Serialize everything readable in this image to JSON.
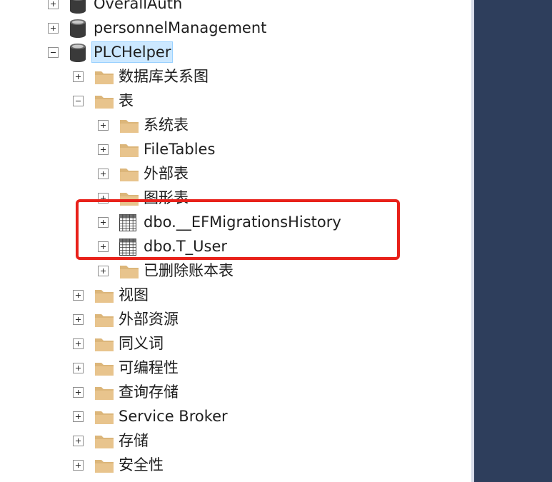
{
  "tree": {
    "nodes": [
      {
        "label": "OverallAuth",
        "type": "database",
        "level": 0,
        "expanded": false
      },
      {
        "label": "personnelManagement",
        "type": "database",
        "level": 0,
        "expanded": false
      },
      {
        "label": "PLCHelper",
        "type": "database",
        "level": 0,
        "expanded": true,
        "selected": true
      },
      {
        "label": "数据库关系图",
        "type": "folder",
        "level": 1,
        "expanded": false
      },
      {
        "label": "表",
        "type": "folder",
        "level": 1,
        "expanded": true
      },
      {
        "label": "系统表",
        "type": "folder",
        "level": 2,
        "expanded": false
      },
      {
        "label": "FileTables",
        "type": "folder",
        "level": 2,
        "expanded": false
      },
      {
        "label": "外部表",
        "type": "folder",
        "level": 2,
        "expanded": false
      },
      {
        "label": "图形表",
        "type": "folder",
        "level": 2,
        "expanded": false
      },
      {
        "label": "dbo.__EFMigrationsHistory",
        "type": "table",
        "level": 2,
        "expanded": false
      },
      {
        "label": "dbo.T_User",
        "type": "table",
        "level": 2,
        "expanded": false
      },
      {
        "label": "已删除账本表",
        "type": "folder",
        "level": 2,
        "expanded": false
      },
      {
        "label": "视图",
        "type": "folder",
        "level": 1,
        "expanded": false
      },
      {
        "label": "外部资源",
        "type": "folder",
        "level": 1,
        "expanded": false
      },
      {
        "label": "同义词",
        "type": "folder",
        "level": 1,
        "expanded": false
      },
      {
        "label": "可编程性",
        "type": "folder",
        "level": 1,
        "expanded": false
      },
      {
        "label": "查询存储",
        "type": "folder",
        "level": 1,
        "expanded": false
      },
      {
        "label": "Service Broker",
        "type": "folder",
        "level": 1,
        "expanded": false
      },
      {
        "label": "存储",
        "type": "folder",
        "level": 1,
        "expanded": false
      },
      {
        "label": "安全性",
        "type": "folder",
        "level": 1,
        "expanded": false
      }
    ]
  },
  "colors": {
    "folder": "#dcb67a",
    "database": "#3a3a3a",
    "highlight": "#e8211a",
    "right_pane": "#2e3e5c",
    "selection": "#cce8ff"
  }
}
